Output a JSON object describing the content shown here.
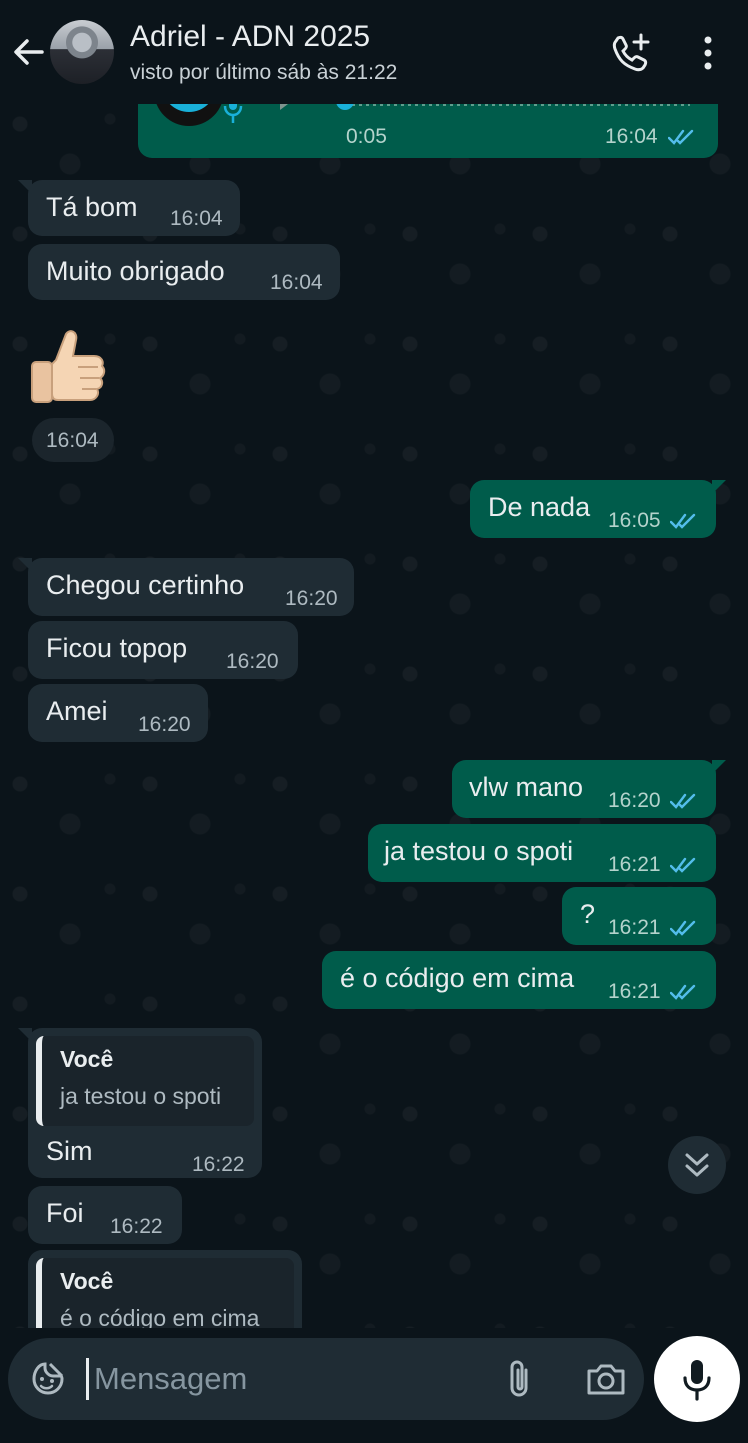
{
  "header": {
    "contact_name": "Adriel - ADN 2025",
    "status": "visto por último sáb às 21:22"
  },
  "audio_message": {
    "duration": "0:05",
    "time": "16:04"
  },
  "messages": [
    {
      "dir": "in",
      "text": "Tá bom",
      "time": "16:04"
    },
    {
      "dir": "in",
      "text": "Muito obrigado",
      "time": "16:04"
    },
    {
      "dir": "in",
      "text": "👍",
      "time": "16:04",
      "emoji_name": "thumbs-up"
    },
    {
      "dir": "out",
      "text": "De nada",
      "time": "16:05",
      "status": "read"
    },
    {
      "dir": "in",
      "text": "Chegou certinho",
      "time": "16:20"
    },
    {
      "dir": "in",
      "text": "Ficou topop",
      "time": "16:20"
    },
    {
      "dir": "in",
      "text": "Amei",
      "time": "16:20"
    },
    {
      "dir": "out",
      "text": "vlw mano",
      "time": "16:20",
      "status": "read"
    },
    {
      "dir": "out",
      "text": "ja testou o spoti",
      "time": "16:21",
      "status": "read"
    },
    {
      "dir": "out",
      "text": "?",
      "time": "16:21",
      "status": "read"
    },
    {
      "dir": "out",
      "text": "é o código em cima",
      "time": "16:21",
      "status": "read"
    },
    {
      "dir": "in",
      "text": "Sim",
      "time": "16:22",
      "reply": {
        "author": "Você",
        "text": "ja testou o spoti"
      }
    },
    {
      "dir": "in",
      "text": "Foi",
      "time": "16:22"
    },
    {
      "dir": "in",
      "text": "",
      "time": "",
      "reply": {
        "author": "Você",
        "text": "é o código em cima"
      }
    }
  ],
  "composer": {
    "placeholder": "Mensagem"
  },
  "colors": {
    "background": "#0b141a",
    "incoming_bubble": "#1f2c34",
    "outgoing_bubble": "#005c4b",
    "read_tick": "#53bdeb"
  }
}
